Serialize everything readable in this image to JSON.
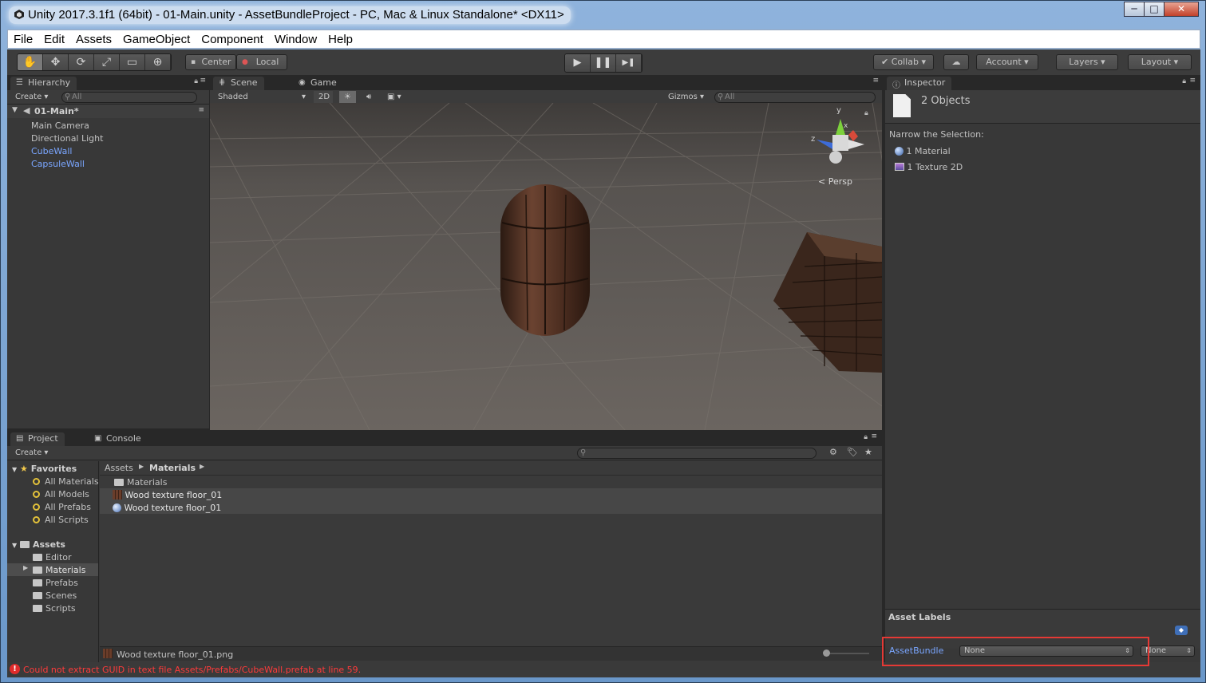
{
  "window": {
    "title": "Unity 2017.3.1f1 (64bit) - 01-Main.unity - AssetBundleProject - PC, Mac & Linux Standalone* <DX11>",
    "minimize": "─",
    "maximize": "□",
    "close": "✕"
  },
  "menu": [
    "File",
    "Edit",
    "Assets",
    "GameObject",
    "Component",
    "Window",
    "Help"
  ],
  "toolbar": {
    "tools": [
      "✋",
      "✥",
      "⟳",
      "⤢",
      "▭",
      "⊕"
    ],
    "pivot": "Center",
    "space": "Local",
    "play": "▶",
    "pause": "❚❚",
    "step": "▶❚",
    "collab": "Collab",
    "account": "Account",
    "layers": "Layers",
    "layout": "Layout"
  },
  "hierarchy": {
    "tab": "Hierarchy",
    "create": "Create",
    "search_placeholder": "All",
    "scene": "01-Main*",
    "items": [
      {
        "label": "Main Camera"
      },
      {
        "label": "Directional Light"
      },
      {
        "label": "CubeWall"
      },
      {
        "label": "CapsuleWall"
      }
    ]
  },
  "scene": {
    "tab_scene": "Scene",
    "tab_game": "Game",
    "shading": "Shaded",
    "mode_2d": "2D",
    "gizmos": "Gizmos",
    "search_placeholder": "All",
    "persp": "Persp",
    "axis_y": "y",
    "axis_z": "z",
    "axis_x": "x"
  },
  "inspector": {
    "tab": "Inspector",
    "objects": "2 Objects",
    "narrow_label": "Narrow the Selection:",
    "items": [
      {
        "label": "1 Material"
      },
      {
        "label": "1 Texture 2D"
      }
    ],
    "asset_labels": "Asset Labels",
    "assetbundle_label": "AssetBundle",
    "assetbundle_value": "None",
    "variant_value": "None"
  },
  "project": {
    "tab_project": "Project",
    "tab_console": "Console",
    "create": "Create",
    "favorites": "Favorites",
    "favorite_items": [
      "All Materials",
      "All Models",
      "All Prefabs",
      "All Scripts"
    ],
    "assets_root": "Assets",
    "asset_folders": [
      "Editor",
      "Materials",
      "Prefabs",
      "Scenes",
      "Scripts"
    ],
    "breadcrumb_root": "Assets",
    "breadcrumb_current": "Materials",
    "files": [
      {
        "label": "Materials"
      },
      {
        "label": "Wood texture floor_01"
      },
      {
        "label": "Wood texture floor_01"
      }
    ],
    "selected_file": "Wood texture floor_01.png"
  },
  "status": {
    "error": "Could not extract GUID in text file Assets/Prefabs/CubeWall.prefab at line 59."
  },
  "colors": {
    "error_red": "#ff3a3a",
    "link_blue": "#7aa6ff",
    "highlight_box": "#e53935",
    "panel_bg": "#383838"
  }
}
